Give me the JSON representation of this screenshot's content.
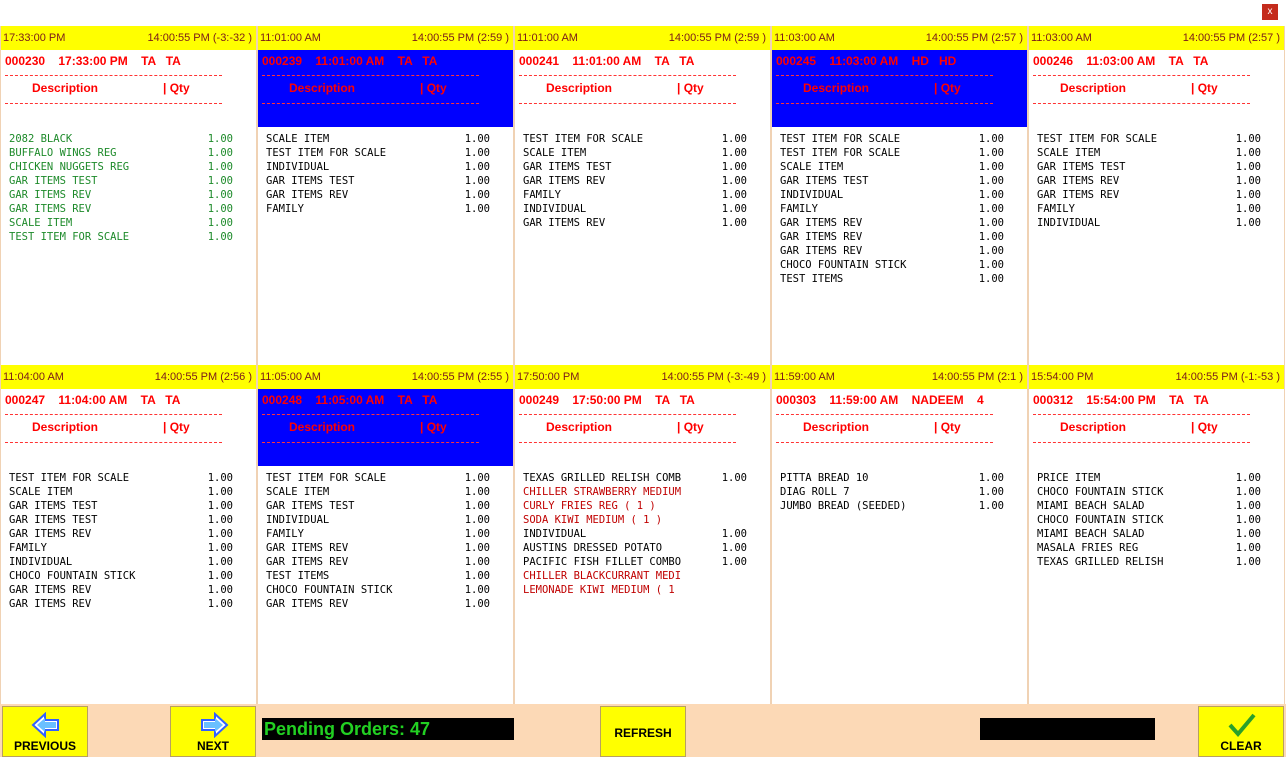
{
  "window": {
    "close_label": "x"
  },
  "orders": [
    {
      "start": "17:33:00 PM",
      "now": "14:00:55 PM  (-3:-32 )",
      "header": "000230    17:33:00 PM    TA   TA",
      "highlight": false,
      "color": "green",
      "items": [
        [
          "2082 BLACK",
          "1.00"
        ],
        [
          "BUFFALO WINGS REG",
          "1.00"
        ],
        [
          "CHICKEN NUGGETS REG",
          "1.00"
        ],
        [
          "GAR ITEMS TEST",
          "1.00"
        ],
        [
          "GAR ITEMS REV",
          "1.00"
        ],
        [
          "GAR ITEMS REV",
          "1.00"
        ],
        [
          "SCALE ITEM",
          "1.00"
        ],
        [
          "TEST ITEM FOR SCALE",
          "1.00"
        ]
      ]
    },
    {
      "start": "11:01:00 AM",
      "now": "14:00:55 PM  (2:59 )",
      "header": "000239    11:01:00 AM    TA   TA",
      "highlight": true,
      "color": "black",
      "items": [
        [
          "SCALE ITEM",
          "1.00"
        ],
        [
          "TEST ITEM FOR SCALE",
          "1.00"
        ],
        [
          "INDIVIDUAL",
          "1.00"
        ],
        [
          "GAR ITEMS TEST",
          "1.00"
        ],
        [
          "GAR ITEMS REV",
          "1.00"
        ],
        [
          "FAMILY",
          "1.00"
        ]
      ]
    },
    {
      "start": "11:01:00 AM",
      "now": "14:00:55 PM  (2:59 )",
      "header": "000241    11:01:00 AM    TA   TA",
      "highlight": false,
      "color": "black",
      "items": [
        [
          "TEST ITEM FOR SCALE",
          "1.00"
        ],
        [
          "SCALE ITEM",
          "1.00"
        ],
        [
          "GAR ITEMS TEST",
          "1.00"
        ],
        [
          "GAR ITEMS REV",
          "1.00"
        ],
        [
          "FAMILY",
          "1.00"
        ],
        [
          "INDIVIDUAL",
          "1.00"
        ],
        [
          "GAR ITEMS REV",
          "1.00"
        ]
      ]
    },
    {
      "start": "11:03:00 AM",
      "now": "14:00:55 PM  (2:57 )",
      "header": "000245    11:03:00 AM    HD   HD",
      "highlight": true,
      "color": "black",
      "items": [
        [
          "TEST ITEM FOR SCALE",
          "1.00"
        ],
        [
          "TEST ITEM FOR SCALE",
          "1.00"
        ],
        [
          "SCALE ITEM",
          "1.00"
        ],
        [
          "GAR ITEMS TEST",
          "1.00"
        ],
        [
          "INDIVIDUAL",
          "1.00"
        ],
        [
          "FAMILY",
          "1.00"
        ],
        [
          "GAR ITEMS REV",
          "1.00"
        ],
        [
          "GAR ITEMS REV",
          "1.00"
        ],
        [
          "GAR ITEMS REV",
          "1.00"
        ],
        [
          "CHOCO FOUNTAIN STICK",
          "1.00"
        ],
        [
          "TEST ITEMS",
          "1.00"
        ]
      ]
    },
    {
      "start": "11:03:00 AM",
      "now": "14:00:55 PM  (2:57 )",
      "header": "000246    11:03:00 AM    TA   TA",
      "highlight": false,
      "color": "black",
      "items": [
        [
          "TEST ITEM FOR SCALE",
          "1.00"
        ],
        [
          "SCALE ITEM",
          "1.00"
        ],
        [
          "GAR ITEMS TEST",
          "1.00"
        ],
        [
          "GAR ITEMS REV",
          "1.00"
        ],
        [
          "GAR ITEMS REV",
          "1.00"
        ],
        [
          "FAMILY",
          "1.00"
        ],
        [
          "INDIVIDUAL",
          "1.00"
        ]
      ]
    },
    {
      "start": "11:04:00 AM",
      "now": "14:00:55 PM  (2:56 )",
      "header": "000247    11:04:00 AM    TA   TA",
      "highlight": false,
      "color": "black",
      "items": [
        [
          "TEST ITEM FOR SCALE",
          "1.00"
        ],
        [
          "SCALE ITEM",
          "1.00"
        ],
        [
          "GAR ITEMS TEST",
          "1.00"
        ],
        [
          "GAR ITEMS TEST",
          "1.00"
        ],
        [
          "GAR ITEMS REV",
          "1.00"
        ],
        [
          "FAMILY",
          "1.00"
        ],
        [
          "INDIVIDUAL",
          "1.00"
        ],
        [
          "CHOCO FOUNTAIN STICK",
          "1.00"
        ],
        [
          "GAR ITEMS REV",
          "1.00"
        ],
        [
          "GAR ITEMS REV",
          "1.00"
        ]
      ]
    },
    {
      "start": "11:05:00 AM",
      "now": "14:00:55 PM  (2:55 )",
      "header": "000248    11:05:00 AM    TA   TA",
      "highlight": true,
      "color": "black",
      "items": [
        [
          "TEST ITEM FOR SCALE",
          "1.00"
        ],
        [
          "SCALE ITEM",
          "1.00"
        ],
        [
          "GAR ITEMS TEST",
          "1.00"
        ],
        [
          "INDIVIDUAL",
          "1.00"
        ],
        [
          "FAMILY",
          "1.00"
        ],
        [
          "GAR ITEMS REV",
          "1.00"
        ],
        [
          "GAR ITEMS REV",
          "1.00"
        ],
        [
          "TEST ITEMS",
          "1.00"
        ],
        [
          "CHOCO FOUNTAIN STICK",
          "1.00"
        ],
        [
          "GAR ITEMS REV",
          "1.00"
        ]
      ]
    },
    {
      "start": "17:50:00 PM",
      "now": "14:00:55 PM  (-3:-49 )",
      "header": "000249    17:50:00 PM    TA   TA",
      "highlight": false,
      "color": "black",
      "items": [
        [
          "TEXAS GRILLED RELISH COMB",
          "1.00",
          "black"
        ],
        [
          "CHILLER STRAWBERRY MEDIUM",
          "",
          "red"
        ],
        [
          "CURLY FRIES REG ( 1 )",
          "",
          "red"
        ],
        [
          "SODA KIWI MEDIUM ( 1 )",
          "",
          "red"
        ],
        [
          "INDIVIDUAL",
          "1.00",
          "black"
        ],
        [
          "AUSTINS DRESSED POTATO",
          "1.00",
          "black"
        ],
        [
          "PACIFIC FISH FILLET COMBO",
          "1.00",
          "black"
        ],
        [
          "CHILLER BLACKCURRANT MEDI",
          "",
          "red"
        ],
        [
          "LEMONADE KIWI MEDIUM ( 1",
          "",
          "red"
        ]
      ]
    },
    {
      "start": "11:59:00 AM",
      "now": "14:00:55 PM  (2:1 )",
      "header": "000303    11:59:00 AM    NADEEM    4",
      "highlight": false,
      "color": "black",
      "items": [
        [
          "PITTA BREAD 10",
          "1.00"
        ],
        [
          "DIAG ROLL 7",
          "1.00"
        ],
        [
          "JUMBO BREAD (SEEDED)",
          "1.00"
        ]
      ]
    },
    {
      "start": "15:54:00 PM",
      "now": "14:00:55 PM  (-1:-53 )",
      "header": "000312    15:54:00 PM    TA   TA",
      "highlight": false,
      "color": "black",
      "items": [
        [
          "PRICE ITEM",
          "1.00"
        ],
        [
          "CHOCO FOUNTAIN STICK",
          "1.00"
        ],
        [
          "MIAMI BEACH SALAD",
          "1.00"
        ],
        [
          "CHOCO FOUNTAIN STICK",
          "1.00"
        ],
        [
          "MIAMI BEACH SALAD",
          "1.00"
        ],
        [
          "MASALA FRIES REG",
          "1.00"
        ],
        [
          "TEXAS GRILLED RELISH",
          "1.00"
        ]
      ]
    }
  ],
  "labels": {
    "description": "Description",
    "qty": "|  Qty"
  },
  "toolbar": {
    "previous_label": "PREVIOUS",
    "next_label": "NEXT",
    "pending_text": "Pending Orders: 47",
    "refresh_label": "REFRESH",
    "clear_label": "CLEAR"
  }
}
